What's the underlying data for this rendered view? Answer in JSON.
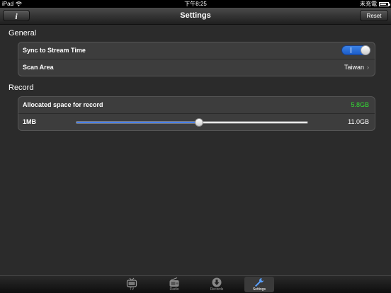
{
  "statusbar": {
    "device": "iPad",
    "time": "下午8:25",
    "battery_text": "未充電"
  },
  "navbar": {
    "title": "Settings",
    "info_label": "i",
    "reset_label": "Reset"
  },
  "general": {
    "title": "General",
    "sync_label": "Sync to Stream Time",
    "sync_on": true,
    "scan_label": "Scan Area",
    "scan_value": "Taiwan"
  },
  "record": {
    "title": "Record",
    "allocated_label": "Allocated space for record",
    "allocated_value": "5.8GB",
    "allocated_color": "#33dd33",
    "min_label": "1MB",
    "max_label": "11.0GB",
    "slider_fraction": 0.527
  },
  "tabs": [
    {
      "label": "TV",
      "icon": "tv-icon",
      "active": false
    },
    {
      "label": "Radio",
      "icon": "radio-icon",
      "active": false
    },
    {
      "label": "Records",
      "icon": "download-icon",
      "active": false
    },
    {
      "label": "Settings",
      "icon": "wrench-icon",
      "active": true
    }
  ],
  "colors": {
    "accent_blue": "#2a6be0",
    "background": "#2b2b2b",
    "group_bg": "#3d3d3d"
  }
}
